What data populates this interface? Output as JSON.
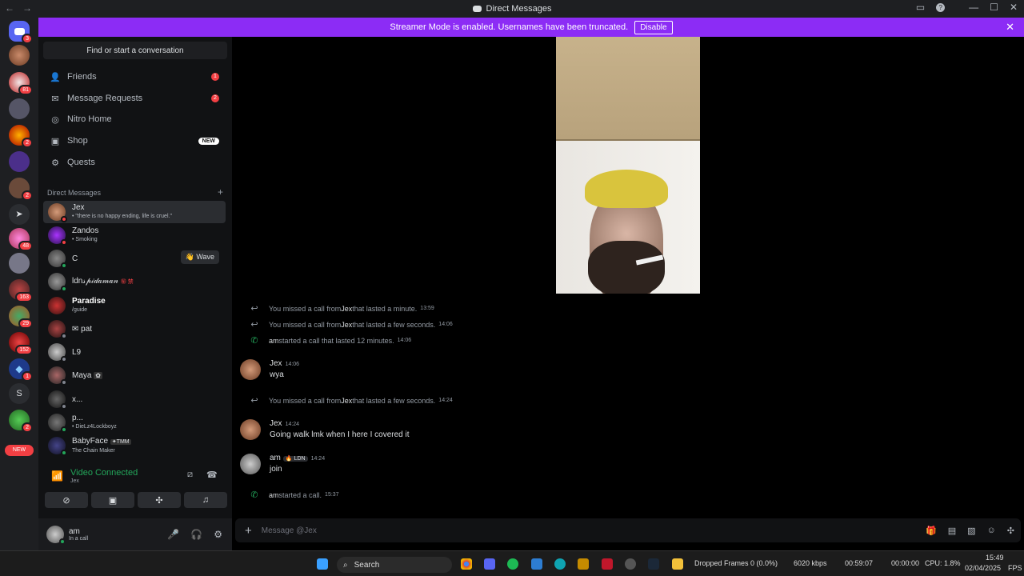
{
  "titlebar": {
    "title": "Direct Messages"
  },
  "banner": {
    "text": "Streamer Mode is enabled. Usernames have been truncated.",
    "button": "Disable",
    "close": "✕"
  },
  "guilds": {
    "badges": [
      "3",
      "81",
      "2",
      "2",
      "4",
      "48",
      "163",
      "29",
      "152",
      "1",
      "2",
      "2"
    ],
    "letter": "S",
    "new_label": "NEW"
  },
  "sidebar": {
    "search_placeholder": "Find or start a conversation",
    "nav": [
      {
        "label": "Friends",
        "icon": "friends-icon",
        "badge": "1"
      },
      {
        "label": "Message Requests",
        "icon": "mail-icon",
        "badge": "2"
      },
      {
        "label": "Nitro Home",
        "icon": "nitro-icon",
        "badge": ""
      },
      {
        "label": "Shop",
        "icon": "shop-icon",
        "tag": "NEW"
      },
      {
        "label": "Quests",
        "icon": "quests-icon",
        "badge": ""
      }
    ],
    "dm_header": "Direct Messages",
    "dm_add": "+",
    "dms": [
      {
        "name": "Jex",
        "sub": "• \"there is no happy ending, life is cruel.\"",
        "status": "on"
      },
      {
        "name": "Zandos",
        "sub": "• Smoking",
        "status": "on"
      },
      {
        "name": "C",
        "sub": "",
        "status": "on",
        "action": "👋 Wave"
      },
      {
        "name": "ldn𝓈𝓅𝒾𝒹𝒶𝓂𝒶𝓃",
        "sub": "",
        "status": "on",
        "tag": "㊙ 禁"
      },
      {
        "name": "Paradise",
        "sub": "/guide",
        "status": "none"
      },
      {
        "name": "✉ pat",
        "sub": "",
        "status": "off"
      },
      {
        "name": "L9",
        "sub": "",
        "status": "off"
      },
      {
        "name": "Maya",
        "sub": "",
        "status": "off",
        "tag": "✿"
      },
      {
        "name": "x...",
        "sub": "",
        "status": "off"
      },
      {
        "name": "p...",
        "sub": "• DieLz4Lockboyz",
        "status": "on"
      },
      {
        "name": "BabyFace",
        "sub": "The Chain Maker",
        "status": "on",
        "tag": "✦TMM"
      }
    ],
    "voice": {
      "status": "Video Connected",
      "channel": "Jex"
    },
    "user": {
      "name": "am",
      "status": "In a call"
    }
  },
  "chat": {
    "events": [
      {
        "kind": "missed",
        "pre": "You missed a call from ",
        "who": "Jex",
        "post": " that lasted a minute.",
        "time": "13:59"
      },
      {
        "kind": "missed",
        "pre": "You missed a call from ",
        "who": "Jex",
        "post": " that lasted a few seconds.",
        "time": "14:06"
      },
      {
        "kind": "started",
        "pre": "",
        "who": "am",
        "post": " started a call that lasted 12 minutes.",
        "time": "14:06"
      }
    ],
    "msg1": {
      "author": "Jex",
      "time": "14:06",
      "text": "wya"
    },
    "event4": {
      "pre": "You missed a call from ",
      "who": "Jex",
      "post": " that lasted a few seconds.",
      "time": "14:24"
    },
    "msg2": {
      "author": "Jex",
      "time": "14:24",
      "text": "Going walk lmk when I here I covered it"
    },
    "msg3": {
      "author": "am",
      "tag": "🔥 LDN",
      "time": "14:24",
      "text": "join"
    },
    "event5": {
      "who": "am",
      "post": " started a call.",
      "time": "15:37"
    },
    "composer_placeholder": "Message @Jex"
  },
  "taskbar": {
    "search": "Search",
    "obs_dropped": "Dropped Frames 0 (0.0%)",
    "obs_kbps": "6020 kbps",
    "obs_time1": "00:59:07",
    "obs_time2": "00:00:00",
    "cpu": "CPU: 1.8%",
    "clock_time": "15:49",
    "clock_date": "02/04/2025",
    "fps": "FPS"
  },
  "colors": {
    "accent": "#8c2cf5",
    "online": "#23a55a",
    "danger": "#f23f43"
  }
}
